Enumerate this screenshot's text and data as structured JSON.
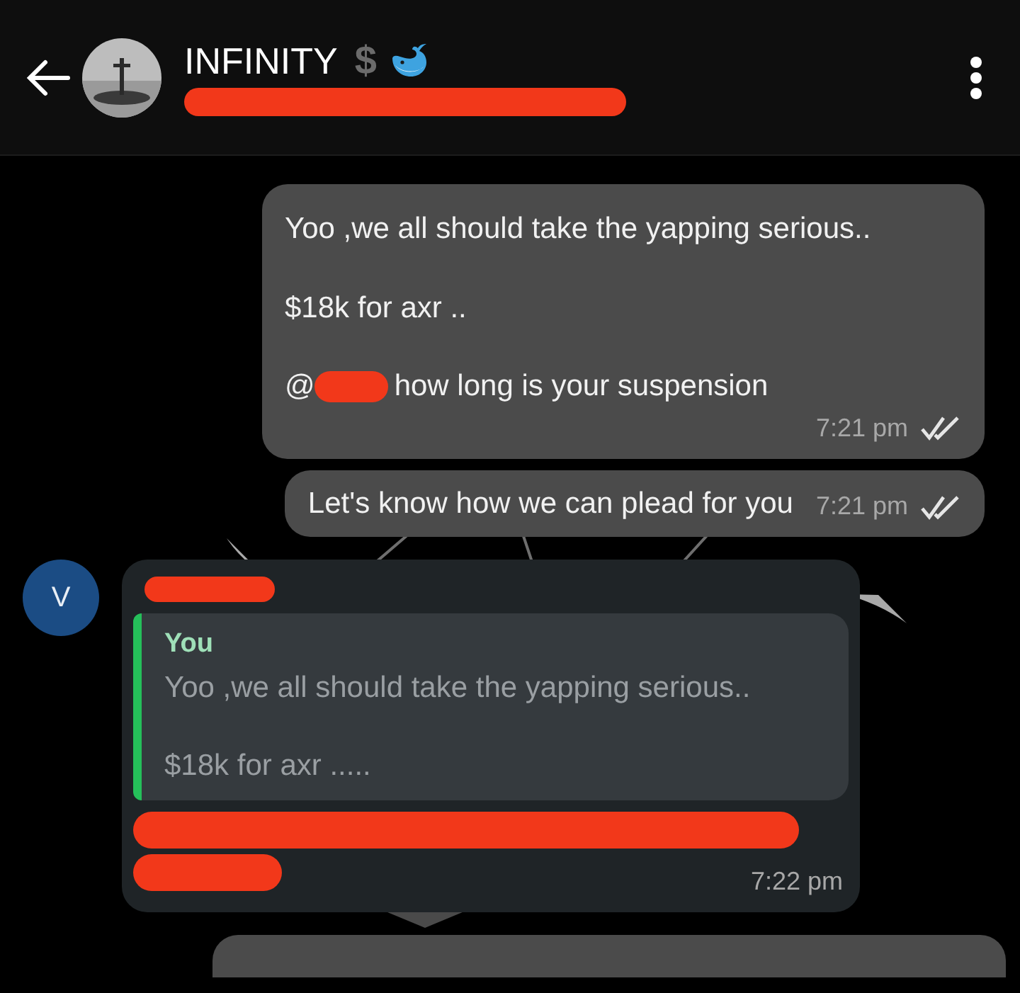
{
  "header": {
    "title": "INFINITY",
    "title_symbol": "$",
    "subtitle_redacted": true
  },
  "messages": [
    {
      "kind": "outgoing",
      "paragraphs": [
        {
          "text": "Yoo ,we all should take the yapping serious.."
        },
        {
          "text": "$18k for axr .."
        },
        {
          "mention": "@",
          "mention_redacted": true,
          "text": "how long is your suspension"
        }
      ],
      "time": "7:21 pm",
      "read": true
    },
    {
      "kind": "outgoing",
      "paragraphs": [
        {
          "text": "Let's know how we can plead for you"
        }
      ],
      "time": "7:21 pm",
      "read": true
    },
    {
      "kind": "incoming",
      "avatar": "V",
      "sender_redacted": true,
      "reply": {
        "author": "You",
        "paragraphs": [
          "Yoo ,we all should take the yapping serious..",
          "$18k for axr ....."
        ]
      },
      "body_redacted": true,
      "time": "7:22 pm"
    },
    {
      "kind": "cut"
    }
  ]
}
